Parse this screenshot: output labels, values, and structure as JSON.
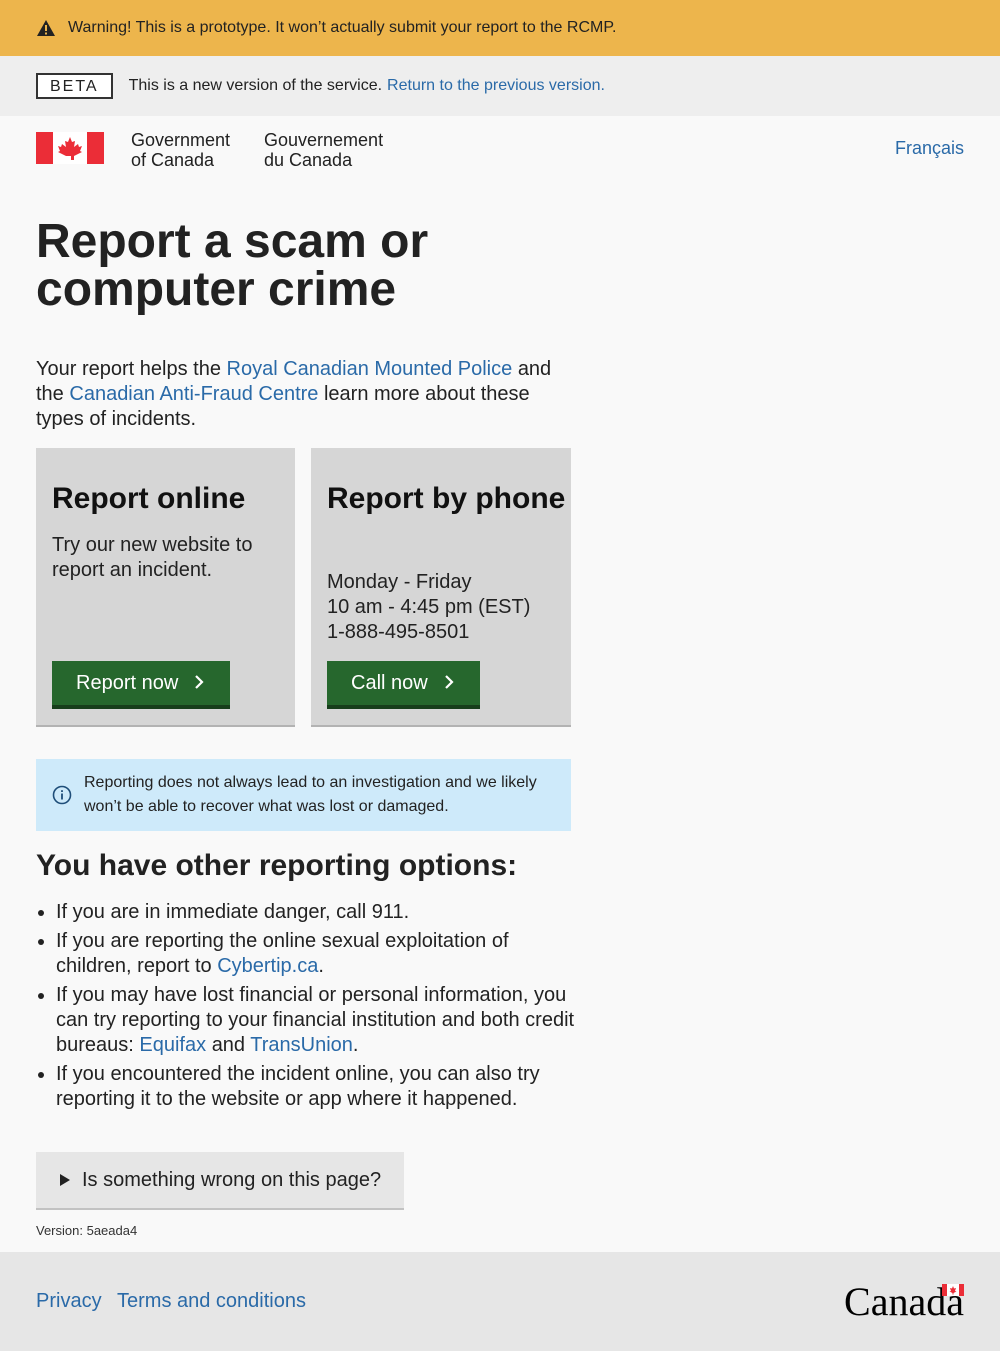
{
  "warning": {
    "strong": "Warning!",
    "text": "This is a prototype. It won’t actually submit your report to the RCMP."
  },
  "beta": {
    "tag": "BETA",
    "text": "This is a new version of the service.",
    "link": "Return to the previous version."
  },
  "header": {
    "gov_en_line1": "Government",
    "gov_en_line2": "of Canada",
    "gov_fr_line1": "Gouvernement",
    "gov_fr_line2": "du Canada",
    "language_link": "Français"
  },
  "main": {
    "title": "Report a scam or computer crime",
    "intro": {
      "part1": "Your report helps the",
      "link1": "Royal Canadian Mounted Police",
      "part2": "and the",
      "link2": "Canadian Anti-Fraud Centre",
      "part3": "learn more about these types of incidents."
    },
    "cards": {
      "online": {
        "title": "Report online",
        "text": "Try our new website to report an incident.",
        "button": "Report now"
      },
      "phone": {
        "title": "Report by phone",
        "hours_days": "Monday - Friday",
        "hours_time": "10 am - 4:45 pm (EST)",
        "phone": "1-888-495-8501",
        "button": "Call now"
      }
    },
    "info": "Reporting does not always lead to an investigation and we likely won’t be able to recover what was lost or damaged.",
    "other_heading": "You have other reporting options:",
    "options": {
      "item1": "If you are in immediate danger, call 911.",
      "item2_text": "If you are reporting the online sexual exploitation of children, report to",
      "item2_link": "Cybertip.ca",
      "item3_text": "If you may have lost financial or personal information, you can try reporting to your financial institution and both credit bureaus:",
      "item3_link1": "Equifax",
      "item3_and": "and",
      "item3_link2": "TransUnion",
      "item4": "If you encountered the incident online, you can also try reporting it to the website or app where it happened."
    },
    "details_summary": "Is something wrong on this page?",
    "version": "Version: 5aeada4"
  },
  "footer": {
    "privacy": "Privacy",
    "terms": "Terms and conditions",
    "wordmark": "Canada"
  },
  "colors": {
    "warning_bg": "#edb54c",
    "link": "#2a6aa8",
    "button_green": "#26672d",
    "info_bg": "#ceeafa",
    "flag_red": "#eb2d37"
  },
  "icons": {
    "warning": "warning-triangle-icon",
    "info": "info-circle-icon",
    "chevron": "chevron-right-icon",
    "details": "triangle-right-icon"
  }
}
